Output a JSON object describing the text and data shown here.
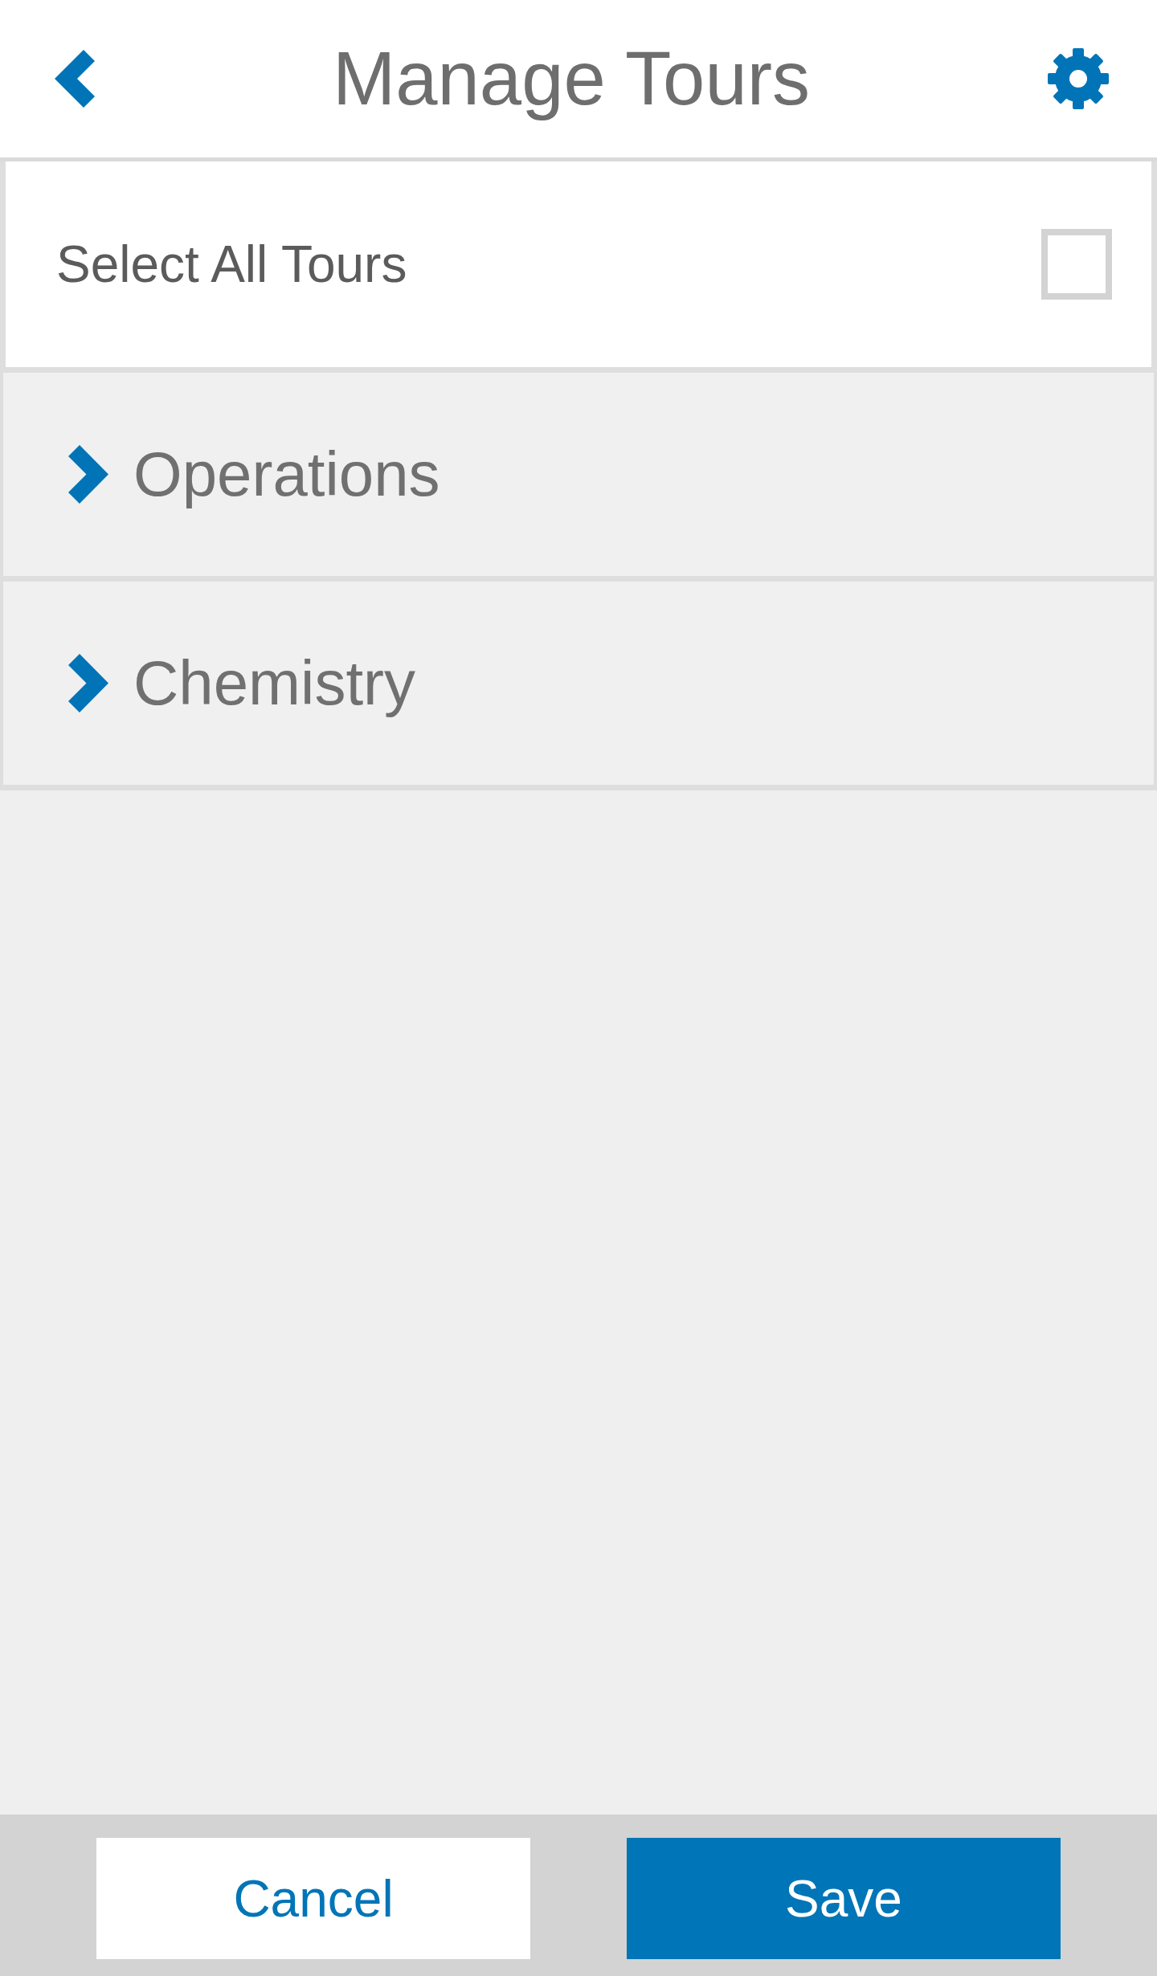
{
  "header": {
    "title": "Manage Tours"
  },
  "select_all": {
    "label": "Select All Tours",
    "checked": false
  },
  "tours": [
    {
      "name": "Operations",
      "expanded": false
    },
    {
      "name": "Chemistry",
      "expanded": false
    }
  ],
  "buttons": [
    {
      "label": "Cancel",
      "kind": "secondary"
    },
    {
      "label": "Save",
      "kind": "primary"
    }
  ]
}
